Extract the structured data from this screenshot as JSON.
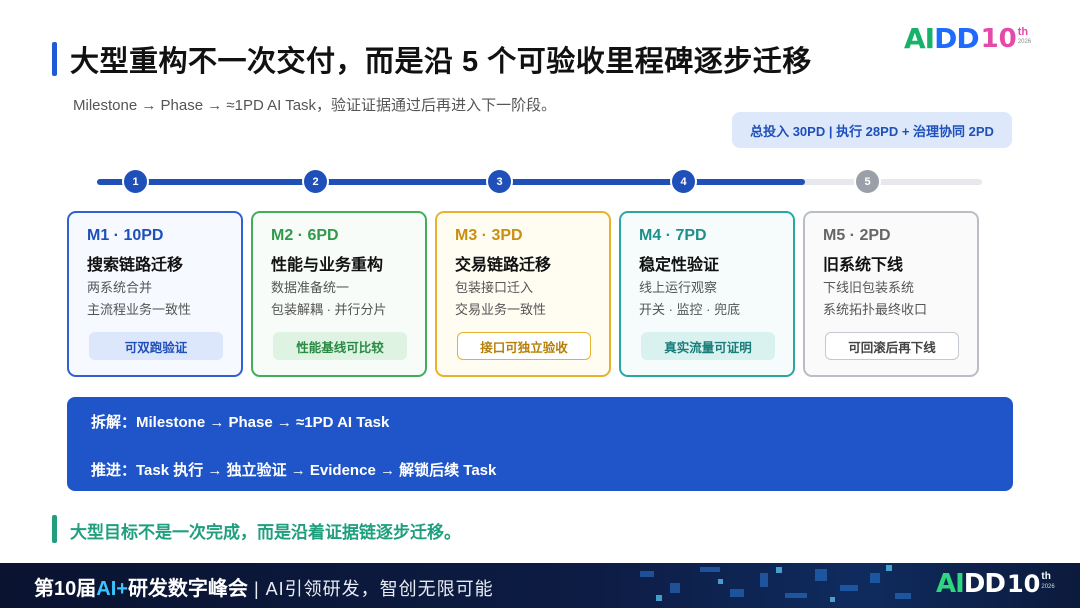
{
  "header": {
    "title": "大型重构不一次交付，而是沿 5 个可验收里程碑逐步迁移",
    "subtitle": "Milestone → Phase → ≈1PD AI Task，验证证据通过后再进入下一阶段。",
    "logo": {
      "ai": "AI",
      "dd": "DD",
      "ten": "10",
      "th": "th",
      "year": "2026"
    }
  },
  "budget": "总投入 30PD | 执行 28PD + 治理协同 2PD",
  "timeline": {
    "nodes": [
      "1",
      "2",
      "3",
      "4",
      "5"
    ],
    "progress": 0.8,
    "colors": {
      "done": "#1f4fb8",
      "pending": "#9aa0a8"
    }
  },
  "milestones": [
    {
      "head": "M1 · 10PD",
      "name": "搜索链路迁移",
      "line1": "两系统合并",
      "line2": "主流程业务一致性",
      "badge": "可双跑验证"
    },
    {
      "head": "M2 · 6PD",
      "name": "性能与业务重构",
      "line1": "数据准备统一",
      "line2": "包装解耦 · 并行分片",
      "badge": "性能基线可比较"
    },
    {
      "head": "M3 · 3PD",
      "name": "交易链路迁移",
      "line1": "包装接口迁入",
      "line2": "交易业务一致性",
      "badge": "接口可独立验收"
    },
    {
      "head": "M4 · 7PD",
      "name": "稳定性验证",
      "line1": "线上运行观察",
      "line2": "开关 · 监控 · 兜底",
      "badge": "真实流量可证明"
    },
    {
      "head": "M5 · 2PD",
      "name": "旧系统下线",
      "line1": "下线旧包装系统",
      "line2": "系统拓扑最终收口",
      "badge": "可回滚后再下线"
    }
  ],
  "panel": {
    "line1": "拆解：Milestone → Phase → ≈1PD AI Task",
    "line2": "推进：Task 执行 → 独立验证 → Evidence → 解锁后续 Task"
  },
  "conclusion": "大型目标不是一次完成，而是沿着证据链逐步迁移。",
  "footer": {
    "prefix": "第10届",
    "ai": "AI+",
    "suffix": "研发数字峰会",
    "slogan": " | AI引领研发，智创无限可能"
  }
}
